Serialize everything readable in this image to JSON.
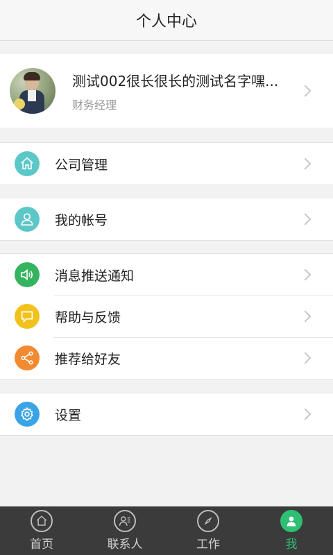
{
  "header": {
    "title": "个人中心"
  },
  "profile": {
    "name": "测试002很长很长的测试名字嘿...",
    "role": "财务经理"
  },
  "menu": {
    "company": {
      "label": "公司管理",
      "icon": "home-icon",
      "color": "#5bc7c6"
    },
    "account": {
      "label": "我的帐号",
      "icon": "user-icon",
      "color": "#5bc7c6"
    },
    "notify": {
      "label": "消息推送通知",
      "icon": "speaker-icon",
      "color": "#36b35f"
    },
    "help": {
      "label": "帮助与反馈",
      "icon": "chat-bubble-icon",
      "color": "#f2c21c"
    },
    "share": {
      "label": "推荐给好友",
      "icon": "share-icon",
      "color": "#f28a31"
    },
    "settings": {
      "label": "设置",
      "icon": "gear-icon",
      "color": "#3aa4e6"
    }
  },
  "tabbar": {
    "home": {
      "label": "首页",
      "icon": "home-icon"
    },
    "contacts": {
      "label": "联系人",
      "icon": "contacts-icon"
    },
    "work": {
      "label": "工作",
      "icon": "compass-icon"
    },
    "me": {
      "label": "我",
      "icon": "person-icon",
      "active": true,
      "color": "#2fbf73"
    }
  }
}
